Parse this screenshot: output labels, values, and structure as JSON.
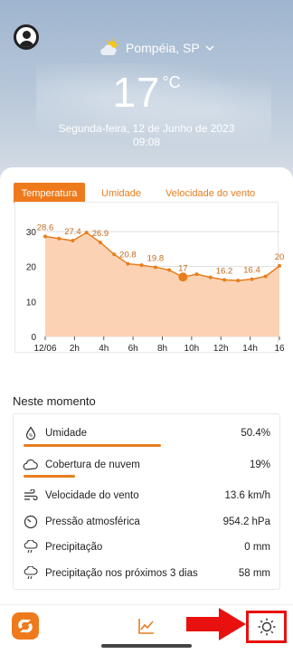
{
  "header": {
    "location": "Pompéia, SP",
    "temperature": "17",
    "temperature_unit": "°C",
    "date": "Segunda-feira, 12 de Junho de 2023",
    "time": "09:08",
    "weather_icon": "sun-behind-cloud-icon"
  },
  "tabs": [
    {
      "label": "Temperatura",
      "active": true
    },
    {
      "label": "Umidade",
      "active": false
    },
    {
      "label": "Velocidade do vento",
      "active": false
    }
  ],
  "chart_data": {
    "type": "area",
    "x_tick_labels": [
      "12/06",
      "2h",
      "4h",
      "6h",
      "8h",
      "10h",
      "12h",
      "14h",
      "16"
    ],
    "y_tick_labels": [
      "0",
      "10",
      "20",
      "30"
    ],
    "ylim": [
      0,
      30
    ],
    "x": [
      0,
      1,
      2,
      3,
      4,
      5,
      6,
      7,
      8,
      9,
      10,
      11,
      12,
      13,
      14,
      15,
      16
    ],
    "values": [
      28.6,
      28,
      27.4,
      29.7,
      26.9,
      23.5,
      20.8,
      20.4,
      19.8,
      19,
      17,
      17.8,
      16.9,
      16.2,
      16,
      16.4,
      17.2,
      20.2
    ],
    "value_labels": [
      {
        "index": 0,
        "text": "28.6"
      },
      {
        "index": 2,
        "text": "27.4"
      },
      {
        "index": 4,
        "text": "26.9"
      },
      {
        "index": 6,
        "text": "20.8"
      },
      {
        "index": 8,
        "text": "19.8"
      },
      {
        "index": 10,
        "text": "17"
      },
      {
        "index": 13,
        "text": "16.2"
      },
      {
        "index": 15,
        "text": "16.4"
      },
      {
        "index": 17,
        "text": "20"
      }
    ],
    "current_index": 10,
    "colors": {
      "line": "#e87e1e",
      "fill": "#fbd3b4",
      "grid": "#dddddd"
    }
  },
  "now": {
    "title": "Neste momento",
    "rows": [
      {
        "icon": "humidity-drop-icon",
        "label": "Umidade",
        "value": "50.4%",
        "bar": 0.504
      },
      {
        "icon": "cloud-icon",
        "label": "Cobertura de nuvem",
        "value": "19%",
        "bar": 0.19
      },
      {
        "icon": "wind-icon",
        "label": "Velocidade do vento",
        "value": "13.6 km/h"
      },
      {
        "icon": "gauge-icon",
        "label": "Pressão atmosférica",
        "value": "954.2 hPa"
      },
      {
        "icon": "rain-cloud-icon",
        "label": "Precipitação",
        "value": "0 mm"
      },
      {
        "icon": "rain-cloud-icon",
        "label": "Precipitação nos próximos 3 dias",
        "value": "58 mm"
      }
    ]
  },
  "bottom_nav": {
    "items": [
      "app-logo-icon",
      "chart-icon",
      "sun-settings-icon"
    ]
  },
  "colors": {
    "accent": "#ef7a1c",
    "highlight_red": "#e8110f"
  }
}
